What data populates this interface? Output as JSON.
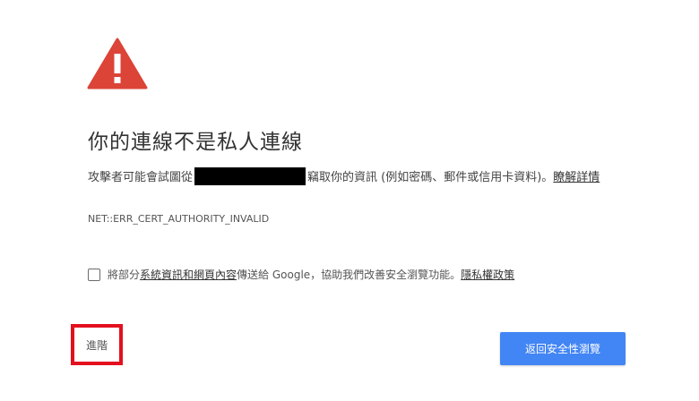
{
  "colors": {
    "warning_icon": "#db4437",
    "primary_button": "#4285f4",
    "highlight_box": "#e3101e",
    "redaction": "#000000"
  },
  "icon": {
    "name": "warning-triangle-icon"
  },
  "heading": {
    "title": "你的連線不是私人連線"
  },
  "description": {
    "before": "攻擊者可能會試圖從",
    "after": "竊取你的資訊 (例如密碼、郵件或信用卡資料)。",
    "learn_more": "瞭解詳情"
  },
  "error_code": "NET::ERR_CERT_AUTHORITY_INVALID",
  "opt_in": {
    "checked": false,
    "prefix": "將部分",
    "link1": "系統資訊和網頁內容",
    "middle": "傳送給 Google，協助我們改善安全瀏覽功能。",
    "link2": "隱私權政策"
  },
  "buttons": {
    "advanced": "進階",
    "back_to_safety": "返回安全性瀏覽"
  }
}
